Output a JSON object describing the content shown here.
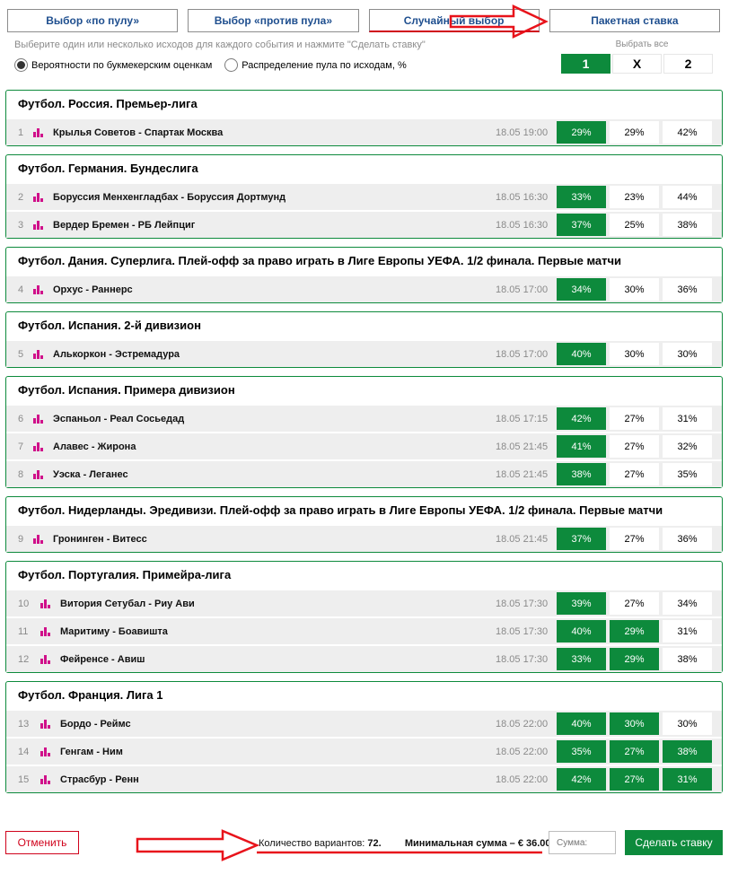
{
  "tabs": [
    {
      "label": "Выбор «по пулу»"
    },
    {
      "label": "Выбор «против пула»"
    },
    {
      "label": "Случайный выбор"
    },
    {
      "label": "Пакетная ставка"
    }
  ],
  "instruction": "Выберите один или несколько исходов для каждого события и нажмите \"Сделать ставку\"",
  "radios": [
    {
      "label": "Вероятности по букмекерским оценкам",
      "checked": true
    },
    {
      "label": "Распределение пула по исходам, %",
      "checked": false
    }
  ],
  "select_all": {
    "label": "Выбрать все",
    "options": [
      "1",
      "X",
      "2"
    ],
    "selected": "1"
  },
  "groups": [
    {
      "title": "Футбол. Россия. Премьер-лига",
      "events": [
        {
          "num": "1",
          "match": "Крылья Советов - Спартак Москва",
          "date": "18.05 19:00",
          "odds": [
            "29%",
            "29%",
            "42%"
          ],
          "selected": [
            0
          ]
        }
      ]
    },
    {
      "title": "Футбол. Германия. Бундеслига",
      "events": [
        {
          "num": "2",
          "match": "Боруссия Менхенгладбах - Боруссия Дортмунд",
          "date": "18.05 16:30",
          "odds": [
            "33%",
            "23%",
            "44%"
          ],
          "selected": [
            0
          ]
        },
        {
          "num": "3",
          "match": "Вердер Бремен - РБ Лейпциг",
          "date": "18.05 16:30",
          "odds": [
            "37%",
            "25%",
            "38%"
          ],
          "selected": [
            0
          ]
        }
      ]
    },
    {
      "title": "Футбол. Дания. Суперлига. Плей-офф за право играть в Лиге Европы УЕФА. 1/2 финала. Первые матчи",
      "events": [
        {
          "num": "4",
          "match": "Орхус - Раннерс",
          "date": "18.05 17:00",
          "odds": [
            "34%",
            "30%",
            "36%"
          ],
          "selected": [
            0
          ]
        }
      ]
    },
    {
      "title": "Футбол. Испания. 2-й дивизион",
      "events": [
        {
          "num": "5",
          "match": "Алькоркон - Эстремадура",
          "date": "18.05 17:00",
          "odds": [
            "40%",
            "30%",
            "30%"
          ],
          "selected": [
            0
          ]
        }
      ]
    },
    {
      "title": "Футбол. Испания. Примера дивизион",
      "events": [
        {
          "num": "6",
          "match": "Эспаньол - Реал Сосьедад",
          "date": "18.05 17:15",
          "odds": [
            "42%",
            "27%",
            "31%"
          ],
          "selected": [
            0
          ]
        },
        {
          "num": "7",
          "match": "Алавес - Жирона",
          "date": "18.05 21:45",
          "odds": [
            "41%",
            "27%",
            "32%"
          ],
          "selected": [
            0
          ]
        },
        {
          "num": "8",
          "match": "Уэска - Леганес",
          "date": "18.05 21:45",
          "odds": [
            "38%",
            "27%",
            "35%"
          ],
          "selected": [
            0
          ]
        }
      ]
    },
    {
      "title": "Футбол. Нидерланды. Эредивизи. Плей-офф за право играть в Лиге Европы УЕФА. 1/2 финала. Первые матчи",
      "events": [
        {
          "num": "9",
          "match": "Гронинген - Витесс",
          "date": "18.05 21:45",
          "odds": [
            "37%",
            "27%",
            "36%"
          ],
          "selected": [
            0
          ]
        }
      ]
    },
    {
      "title": "Футбол. Португалия. Примейра-лига",
      "events": [
        {
          "num": "10",
          "match": "Витория Сетубал - Риу Ави",
          "date": "18.05 17:30",
          "odds": [
            "39%",
            "27%",
            "34%"
          ],
          "selected": [
            0
          ]
        },
        {
          "num": "11",
          "match": "Маритиму - Боавишта",
          "date": "18.05 17:30",
          "odds": [
            "40%",
            "29%",
            "31%"
          ],
          "selected": [
            0,
            1
          ]
        },
        {
          "num": "12",
          "match": "Фейренсе - Авиш",
          "date": "18.05 17:30",
          "odds": [
            "33%",
            "29%",
            "38%"
          ],
          "selected": [
            0,
            1
          ]
        }
      ]
    },
    {
      "title": "Футбол. Франция. Лига 1",
      "events": [
        {
          "num": "13",
          "match": "Бордо - Реймс",
          "date": "18.05 22:00",
          "odds": [
            "40%",
            "30%",
            "30%"
          ],
          "selected": [
            0,
            1
          ]
        },
        {
          "num": "14",
          "match": "Генгам - Ним",
          "date": "18.05 22:00",
          "odds": [
            "35%",
            "27%",
            "38%"
          ],
          "selected": [
            0,
            1,
            2
          ]
        },
        {
          "num": "15",
          "match": "Страсбур - Ренн",
          "date": "18.05 22:00",
          "odds": [
            "42%",
            "27%",
            "31%"
          ],
          "selected": [
            0,
            1,
            2
          ]
        }
      ]
    }
  ],
  "footer": {
    "cancel_label": "Отменить",
    "variants_label": "Количество вариантов:",
    "variants_count": "72.",
    "min_sum_text": "Минимальная сумма – € 36.00",
    "sum_placeholder": "Сумма:",
    "bet_label": "Сделать ставку"
  },
  "colors": {
    "accent_green": "#0d8a3c",
    "link_blue": "#1f4f8f",
    "alert_red": "#d0021b",
    "stat_icon": "#d0108a"
  }
}
